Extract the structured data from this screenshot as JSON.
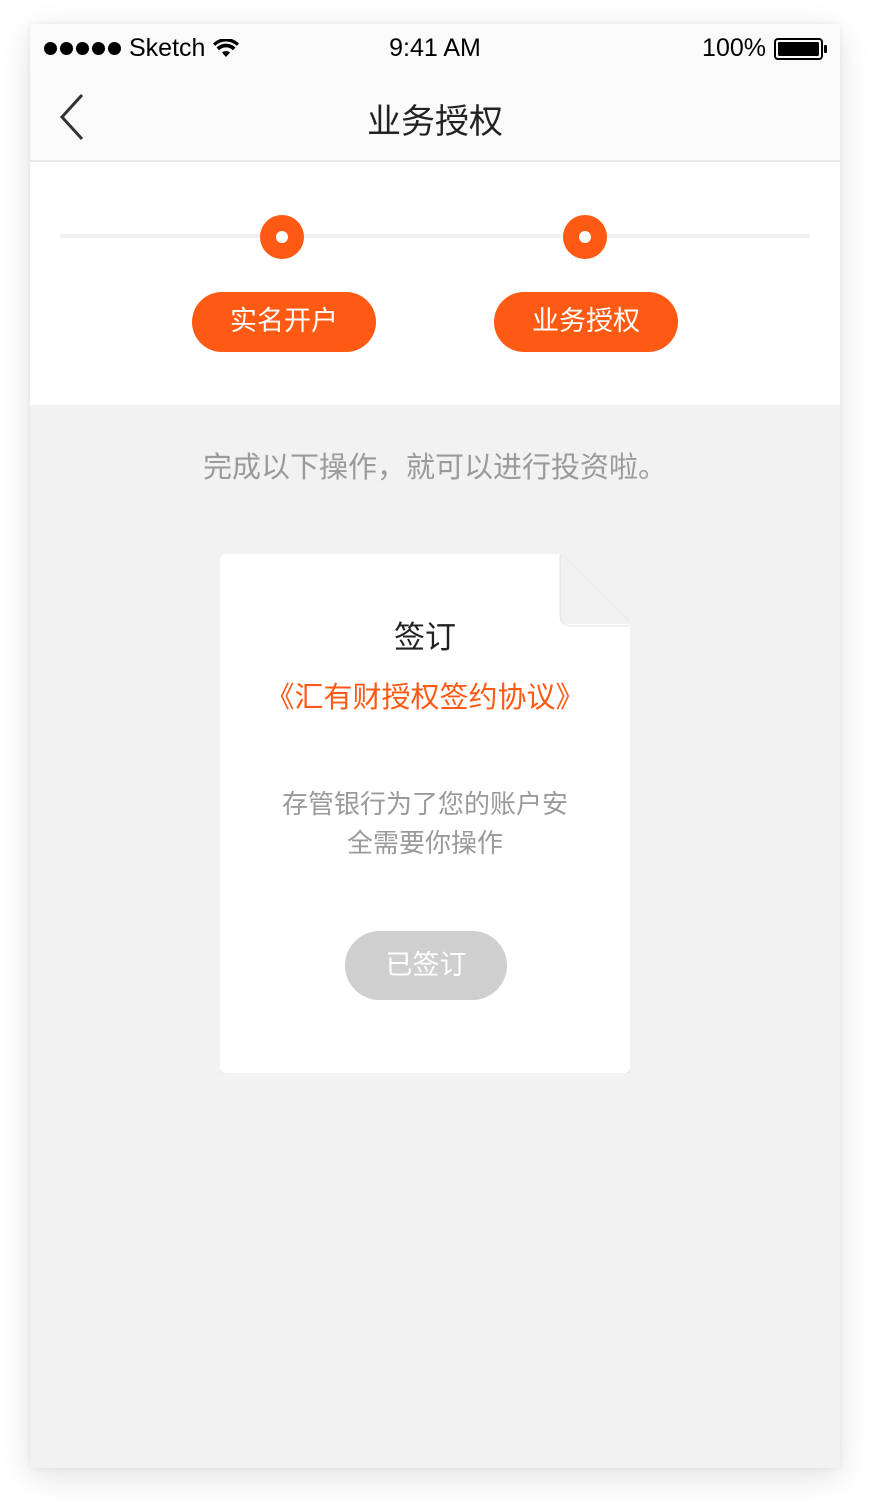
{
  "status_bar": {
    "carrier": "Sketch",
    "time": "9:41 AM",
    "battery": "100%"
  },
  "nav": {
    "title": "业务授权",
    "back_icon": "chevron-left-icon"
  },
  "steps": [
    {
      "label": "实名开户"
    },
    {
      "label": "业务授权"
    }
  ],
  "hint": "完成以下操作，就可以进行投资啦。",
  "card": {
    "title": "签订",
    "agreement_link": "《汇有财授权签约协议》",
    "description": "存管银行为了您的账户安全需要你操作",
    "button_label": "已签订"
  },
  "colors": {
    "accent": "#ff5a14",
    "background": "#f2f2f2",
    "disabled_button": "#cfcfcf",
    "muted_text": "#9a9a9a"
  }
}
